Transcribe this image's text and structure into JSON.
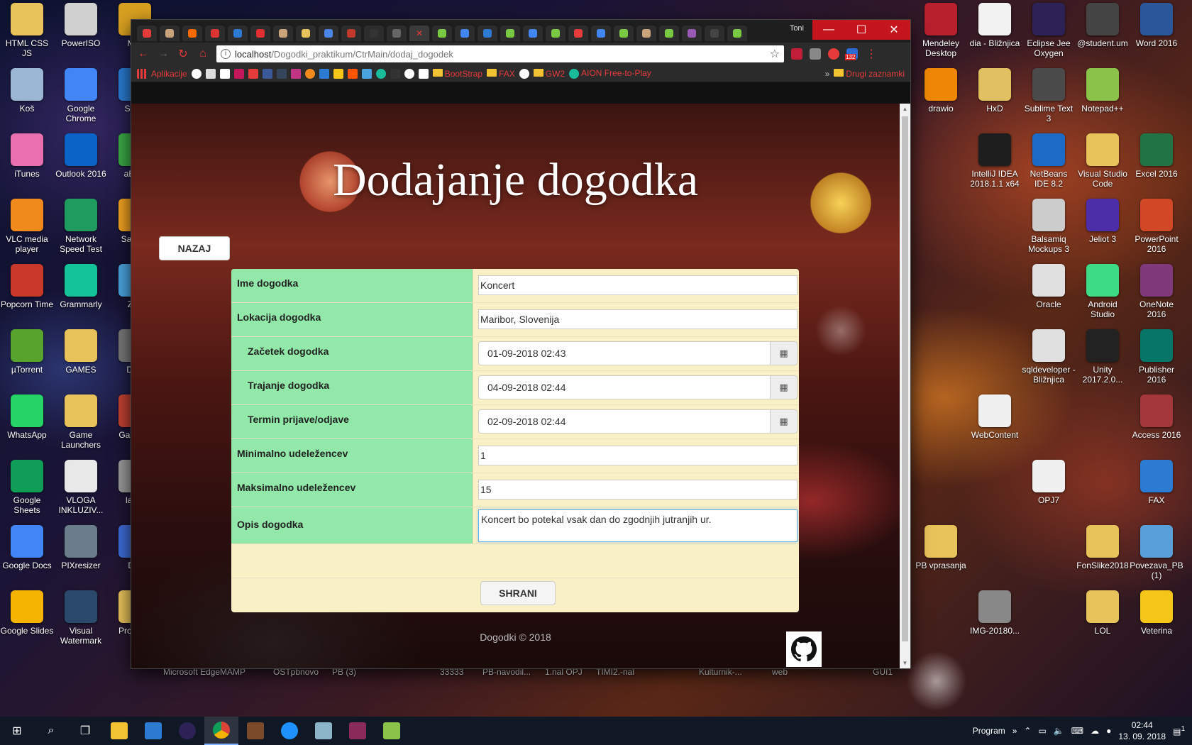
{
  "desktop": {
    "left_icons": [
      {
        "label": "HTML CSS JS",
        "color": "#e8c25a"
      },
      {
        "label": "PowerISO",
        "color": "#d0d0d0"
      },
      {
        "label": "MSi",
        "color": "#d8a020"
      },
      {
        "label": "Koš",
        "color": "#9bb7d4"
      },
      {
        "label": "Google Chrome",
        "color": "#4285f4"
      },
      {
        "label": "Smar",
        "color": "#2a7bd1"
      },
      {
        "label": "iTunes",
        "color": "#e86fb0"
      },
      {
        "label": "Outlook 2016",
        "color": "#0a64c8"
      },
      {
        "label": "aExm",
        "color": "#3aa845"
      },
      {
        "label": "VLC media player",
        "color": "#f08a1c"
      },
      {
        "label": "Network Speed Test",
        "color": "#1f9b5f"
      },
      {
        "label": "Sam Ki",
        "color": "#f0a020"
      },
      {
        "label": "Popcorn Time",
        "color": "#c9392b"
      },
      {
        "label": "Grammarly",
        "color": "#15c39a"
      },
      {
        "label": "Zab",
        "color": "#4aa3df"
      },
      {
        "label": "µTorrent",
        "color": "#58a32e"
      },
      {
        "label": "GAMES",
        "color": "#e8c25a"
      },
      {
        "label": "DYb",
        "color": "#777"
      },
      {
        "label": "WhatsApp",
        "color": "#25d366"
      },
      {
        "label": "Game Launchers",
        "color": "#e8c25a"
      },
      {
        "label": "Gam My",
        "color": "#c04030"
      },
      {
        "label": "Google Sheets",
        "color": "#0f9d58"
      },
      {
        "label": "VLOGA INKLUZIV...",
        "color": "#e8e8e8"
      },
      {
        "label": "lapto",
        "color": "#999"
      },
      {
        "label": "Google Docs",
        "color": "#4285f4"
      },
      {
        "label": "PIXresizer",
        "color": "#6a7d8a"
      },
      {
        "label": "Dro",
        "color": "#3d6bd6"
      },
      {
        "label": "Google Slides",
        "color": "#f4b400"
      },
      {
        "label": "Visual Watermark",
        "color": "#2b4a6b"
      },
      {
        "label": "Program",
        "color": "#e8c25a"
      }
    ],
    "bottom_labels": [
      "Microsoft Edge",
      "MAMP",
      "OSTpbnovo",
      "PB (3)",
      "33333",
      "PB-navodil...",
      "1.nal OPJ",
      "TIMI2.-nal",
      "Kulturnik-...",
      "web",
      "GUI1"
    ],
    "right_icons": [
      {
        "label": "Mendeley Desktop",
        "color": "#b8202e"
      },
      {
        "label": "dia - Bližnjica",
        "color": "#f2f2f2"
      },
      {
        "label": "Eclipse Jee Oxygen",
        "color": "#2c2255"
      },
      {
        "label": "@student.um",
        "color": "#444"
      },
      {
        "label": "Word 2016",
        "color": "#2b579a"
      },
      {
        "label": "drawio",
        "color": "#f08705"
      },
      {
        "label": "HxD",
        "color": "#e0c060"
      },
      {
        "label": "Sublime Text 3",
        "color": "#4b4b4b"
      },
      {
        "label": "Notepad++",
        "color": "#8bc34a"
      },
      {
        "label": "IntelliJ IDEA 2018.1.1 x64",
        "color": "#1e1e1e"
      },
      {
        "label": "NetBeans IDE 8.2",
        "color": "#1b6ac6"
      },
      {
        "label": "Visual Studio Code",
        "color": "#e8c25a"
      },
      {
        "label": "Excel 2016",
        "color": "#217346"
      },
      {
        "label": "Balsamiq Mockups 3",
        "color": "#cccccc"
      },
      {
        "label": "Jeliot 3",
        "color": "#4b2ea8"
      },
      {
        "label": "PowerPoint 2016",
        "color": "#d24726"
      },
      {
        "label": "Oracle",
        "color": "#e0e0e0"
      },
      {
        "label": "Android Studio",
        "color": "#3ddc84"
      },
      {
        "label": "OneNote 2016",
        "color": "#80397b"
      },
      {
        "label": "sqldeveloper - Bližnjica",
        "color": "#e0e0e0"
      },
      {
        "label": "Unity 2017.2.0...",
        "color": "#222"
      },
      {
        "label": "Publisher 2016",
        "color": "#077568"
      },
      {
        "label": "WebContent",
        "color": "#f0f0f0"
      },
      {
        "label": "Access 2016",
        "color": "#a4373a"
      },
      {
        "label": "OPJ7",
        "color": "#f0f0f0"
      },
      {
        "label": "FAX",
        "color": "#2a7bd1"
      },
      {
        "label": "PB vprasanja",
        "color": "#e8c25a"
      },
      {
        "label": "FonSlike2018",
        "color": "#e8c25a"
      },
      {
        "label": "Povezava_PB (1)",
        "color": "#5aa0d8"
      },
      {
        "label": "IMG-20180...",
        "color": "#888"
      },
      {
        "label": "LOL",
        "color": "#e8c25a"
      },
      {
        "label": "Veterina",
        "color": "#f5c518"
      }
    ]
  },
  "taskbar": {
    "tray_label": "Program",
    "time": "02:44",
    "date": "13. 09. 2018",
    "notification_count": "1",
    "chevron": "»"
  },
  "browser": {
    "user": "Toni",
    "url_host": "localhost",
    "url_path": "/Dogodki_praktikum/CtrMain/dodaj_dogodek",
    "info_icon": "i",
    "badge_count": "132",
    "bookmarks": {
      "apps": "Aplikacije",
      "bootstrap": "BootStrap",
      "fax": "FAX",
      "gw2": "GW2",
      "aion": "AION Free-to-Play",
      "overflow": "»",
      "other": "Drugi zaznamki"
    }
  },
  "page": {
    "title": "Dodajanje dogodka",
    "back_button": "NAZAJ",
    "fields": {
      "name_label": "Ime dogodka",
      "name_value": "Koncert",
      "location_label": "Lokacija dogodka",
      "location_value": "Maribor, Slovenija",
      "start_label": "Začetek dogodka",
      "start_value": "01-09-2018 02:43",
      "duration_label": "Trajanje dogodka",
      "duration_value": "04-09-2018 02:44",
      "deadline_label": "Termin prijave/odjave",
      "deadline_value": "02-09-2018 02:44",
      "min_label": "Minimalno udeležencev",
      "min_value": "1",
      "max_label": "Maksimalno udeležencev",
      "max_value": "15",
      "desc_label": "Opis dogodka",
      "desc_value": "Koncert bo potekal vsak dan do zgodnjih jutranjih ur."
    },
    "save_button": "SHRANI",
    "footer": "Dogodki © 2018"
  }
}
